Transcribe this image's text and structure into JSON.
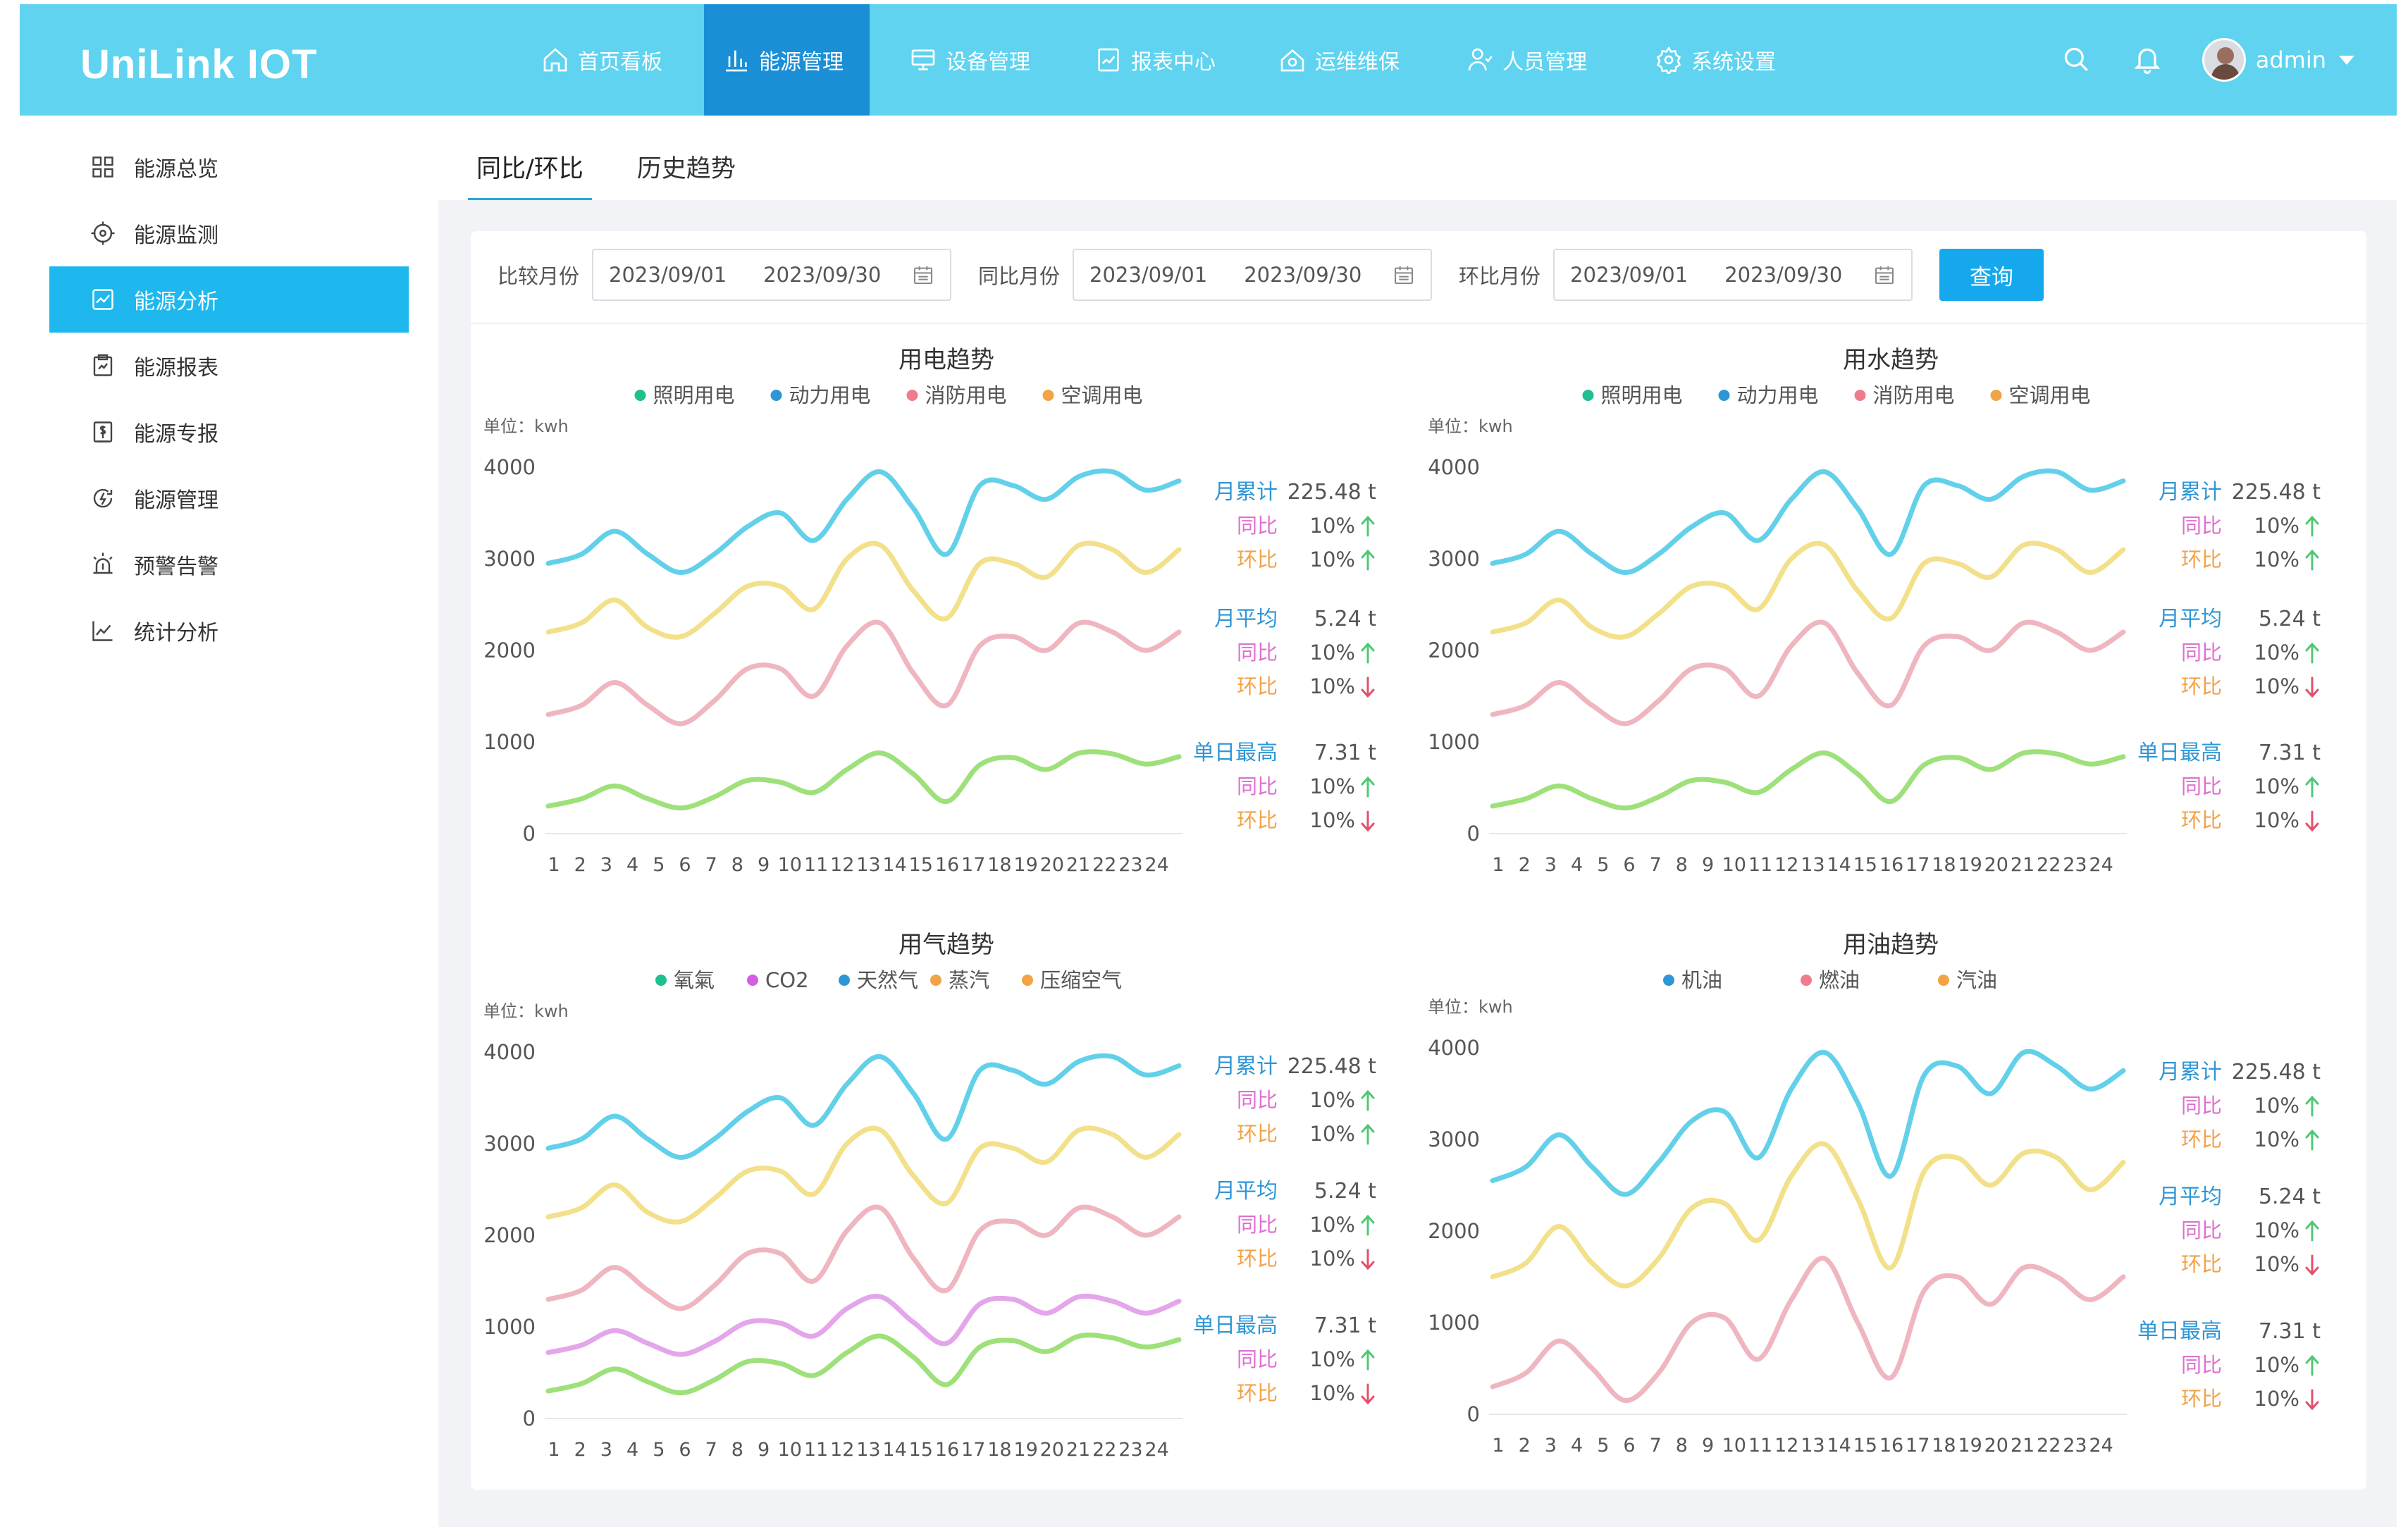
{
  "header": {
    "logo": "UniLink IOT",
    "nav": [
      {
        "label": "首页看板",
        "icon": "home-icon"
      },
      {
        "label": "能源管理",
        "icon": "bar-chart-icon",
        "active": true
      },
      {
        "label": "设备管理",
        "icon": "device-icon"
      },
      {
        "label": "报表中心",
        "icon": "report-icon"
      },
      {
        "label": "运维维保",
        "icon": "maintenance-icon"
      },
      {
        "label": "人员管理",
        "icon": "people-icon"
      },
      {
        "label": "系统设置",
        "icon": "gear-icon"
      }
    ],
    "user": "admin"
  },
  "sidebar": {
    "items": [
      {
        "label": "能源总览",
        "icon": "grid-icon"
      },
      {
        "label": "能源监测",
        "icon": "monitor-icon"
      },
      {
        "label": "能源分析",
        "icon": "analysis-icon",
        "active": true
      },
      {
        "label": "能源报表",
        "icon": "clipboard-icon"
      },
      {
        "label": "能源专报",
        "icon": "special-report-icon"
      },
      {
        "label": "能源管理",
        "icon": "energy-manage-icon"
      },
      {
        "label": "预警告警",
        "icon": "alarm-icon"
      },
      {
        "label": "统计分析",
        "icon": "line-chart-icon"
      }
    ]
  },
  "tabs": [
    {
      "label": "同比/环比",
      "active": true
    },
    {
      "label": "历史趋势"
    }
  ],
  "filters": [
    {
      "label": "比较月份",
      "start": "2023/09/01",
      "end": "2023/09/30"
    },
    {
      "label": "同比月份",
      "start": "2023/09/01",
      "end": "2023/09/30"
    },
    {
      "label": "环比月份",
      "start": "2023/09/01",
      "end": "2023/09/30"
    }
  ],
  "query_label": "查询",
  "colors": {
    "cyan": "#63d0ea",
    "yellow": "#f2e08a",
    "pink": "#efb6c0",
    "green": "#9ee07a",
    "violet": "#e3a6ea",
    "up": "#4fc873",
    "down": "#e2506a",
    "label_blue": "#2f96d6",
    "label_pink": "#e06fcf",
    "label_orange": "#f2a247"
  },
  "stats": [
    {
      "name": "月累计",
      "value": "225.48 t",
      "rows": [
        {
          "label": "同比",
          "value": "10%",
          "dir": "up"
        },
        {
          "label": "环比",
          "value": "10%",
          "dir": "up"
        }
      ]
    },
    {
      "name": "月平均",
      "value": "5.24 t",
      "rows": [
        {
          "label": "同比",
          "value": "10%",
          "dir": "up"
        },
        {
          "label": "环比",
          "value": "10%",
          "dir": "down"
        }
      ]
    },
    {
      "name": "单日最高",
      "value": "7.31 t",
      "rows": [
        {
          "label": "同比",
          "value": "10%",
          "dir": "up"
        },
        {
          "label": "环比",
          "value": "10%",
          "dir": "down"
        }
      ]
    }
  ],
  "chart_data": [
    {
      "type": "line",
      "title": "用电趋势",
      "unit": "单位：kwh",
      "x": [
        1,
        2,
        3,
        4,
        5,
        6,
        7,
        8,
        9,
        10,
        11,
        12,
        13,
        14,
        15,
        16,
        17,
        18,
        19,
        20,
        21,
        22,
        23,
        24
      ],
      "ylim": [
        0,
        4000
      ],
      "yticks": [
        0,
        1000,
        2000,
        3000,
        4000
      ],
      "legend": [
        {
          "name": "照明用电",
          "color": "#1fbf8f"
        },
        {
          "name": "动力用电",
          "color": "#2f96d6"
        },
        {
          "name": "消防用电",
          "color": "#ee7c8c"
        },
        {
          "name": "空调用电",
          "color": "#f2a247"
        }
      ],
      "series": [
        {
          "color": "#63d0ea",
          "values": [
            2950,
            3050,
            3300,
            3050,
            2850,
            3050,
            3350,
            3500,
            3200,
            3650,
            3950,
            3550,
            3050,
            3800,
            3800,
            3650,
            3900,
            3950,
            3750,
            3850
          ]
        },
        {
          "color": "#f2e08a",
          "values": [
            2200,
            2300,
            2550,
            2250,
            2150,
            2400,
            2700,
            2700,
            2450,
            3000,
            3150,
            2650,
            2350,
            2950,
            2950,
            2800,
            3150,
            3100,
            2850,
            3100
          ]
        },
        {
          "color": "#efb6c0",
          "values": [
            1300,
            1400,
            1650,
            1400,
            1200,
            1450,
            1800,
            1800,
            1500,
            2050,
            2300,
            1750,
            1400,
            2050,
            2150,
            2000,
            2300,
            2200,
            2000,
            2200
          ]
        },
        {
          "color": "#9ee07a",
          "values": [
            300,
            380,
            520,
            380,
            280,
            400,
            580,
            560,
            450,
            700,
            880,
            650,
            350,
            750,
            830,
            700,
            880,
            870,
            760,
            840
          ]
        }
      ]
    },
    {
      "type": "line",
      "title": "用水趋势",
      "unit": "单位：kwh",
      "x": [
        1,
        2,
        3,
        4,
        5,
        6,
        7,
        8,
        9,
        10,
        11,
        12,
        13,
        14,
        15,
        16,
        17,
        18,
        19,
        20,
        21,
        22,
        23,
        24
      ],
      "ylim": [
        0,
        4000
      ],
      "yticks": [
        0,
        1000,
        2000,
        3000,
        4000
      ],
      "legend": [
        {
          "name": "照明用电",
          "color": "#1fbf8f"
        },
        {
          "name": "动力用电",
          "color": "#2f96d6"
        },
        {
          "name": "消防用电",
          "color": "#ee7c8c"
        },
        {
          "name": "空调用电",
          "color": "#f2a247"
        }
      ],
      "series": [
        {
          "color": "#63d0ea",
          "values": [
            2950,
            3050,
            3300,
            3050,
            2850,
            3050,
            3350,
            3500,
            3200,
            3650,
            3950,
            3550,
            3050,
            3800,
            3800,
            3650,
            3900,
            3950,
            3750,
            3850
          ]
        },
        {
          "color": "#f2e08a",
          "values": [
            2200,
            2300,
            2550,
            2250,
            2150,
            2400,
            2700,
            2700,
            2450,
            3000,
            3150,
            2650,
            2350,
            2950,
            2950,
            2800,
            3150,
            3100,
            2850,
            3100
          ]
        },
        {
          "color": "#efb6c0",
          "values": [
            1300,
            1400,
            1650,
            1400,
            1200,
            1450,
            1800,
            1800,
            1500,
            2050,
            2300,
            1750,
            1400,
            2050,
            2150,
            2000,
            2300,
            2200,
            2000,
            2200
          ]
        },
        {
          "color": "#9ee07a",
          "values": [
            300,
            380,
            520,
            380,
            280,
            400,
            580,
            560,
            450,
            700,
            880,
            650,
            350,
            750,
            830,
            700,
            880,
            870,
            760,
            840
          ]
        }
      ]
    },
    {
      "type": "line",
      "title": "用气趋势",
      "unit": "单位：kwh",
      "x": [
        1,
        2,
        3,
        4,
        5,
        6,
        7,
        8,
        9,
        10,
        11,
        12,
        13,
        14,
        15,
        16,
        17,
        18,
        19,
        20,
        21,
        22,
        23,
        24
      ],
      "ylim": [
        0,
        4000
      ],
      "yticks": [
        0,
        1000,
        2000,
        3000,
        4000
      ],
      "legend": [
        {
          "name": "氧氣",
          "color": "#1fbf8f"
        },
        {
          "name": "CO2",
          "color": "#d65ce6"
        },
        {
          "name": "天然气",
          "color": "#2f96d6"
        },
        {
          "name": "蒸汽",
          "color": "#f2a247"
        },
        {
          "name": "压缩空气",
          "color": "#f2a247"
        }
      ],
      "series": [
        {
          "color": "#63d0ea",
          "values": [
            2950,
            3050,
            3300,
            3050,
            2850,
            3050,
            3350,
            3500,
            3200,
            3650,
            3950,
            3550,
            3050,
            3800,
            3800,
            3650,
            3900,
            3950,
            3750,
            3850
          ]
        },
        {
          "color": "#f2e08a",
          "values": [
            2200,
            2300,
            2550,
            2250,
            2150,
            2400,
            2700,
            2700,
            2450,
            3000,
            3150,
            2650,
            2350,
            2950,
            2950,
            2800,
            3150,
            3100,
            2850,
            3100
          ]
        },
        {
          "color": "#efb6c0",
          "values": [
            1300,
            1400,
            1650,
            1400,
            1200,
            1450,
            1800,
            1800,
            1500,
            2050,
            2300,
            1750,
            1400,
            2050,
            2150,
            2000,
            2300,
            2200,
            2000,
            2200
          ]
        },
        {
          "color": "#e3a6ea",
          "values": [
            720,
            800,
            960,
            820,
            700,
            840,
            1050,
            1040,
            900,
            1200,
            1330,
            1050,
            820,
            1250,
            1300,
            1150,
            1330,
            1280,
            1150,
            1280
          ]
        },
        {
          "color": "#9ee07a",
          "values": [
            300,
            380,
            540,
            400,
            280,
            420,
            620,
            600,
            470,
            720,
            900,
            670,
            370,
            780,
            850,
            730,
            900,
            880,
            780,
            860
          ]
        }
      ]
    },
    {
      "type": "line",
      "title": "用油趋势",
      "unit": "单位：kwh",
      "x": [
        1,
        2,
        3,
        4,
        5,
        6,
        7,
        8,
        9,
        10,
        11,
        12,
        13,
        14,
        15,
        16,
        17,
        18,
        19,
        20,
        21,
        22,
        23,
        24
      ],
      "ylim": [
        0,
        4000
      ],
      "yticks": [
        0,
        1000,
        2000,
        3000,
        4000
      ],
      "legend": [
        {
          "name": "机油",
          "color": "#2f96d6"
        },
        {
          "name": "燃油",
          "color": "#ee7c8c"
        },
        {
          "name": "汽油",
          "color": "#f2a247"
        }
      ],
      "series": [
        {
          "color": "#63d0ea",
          "values": [
            2550,
            2700,
            3050,
            2700,
            2400,
            2750,
            3200,
            3300,
            2800,
            3550,
            3950,
            3400,
            2600,
            3700,
            3800,
            3500,
            3950,
            3800,
            3550,
            3750
          ]
        },
        {
          "color": "#f2e08a",
          "values": [
            1500,
            1650,
            2050,
            1650,
            1400,
            1700,
            2250,
            2300,
            1900,
            2600,
            2950,
            2350,
            1600,
            2650,
            2800,
            2500,
            2850,
            2800,
            2450,
            2750
          ]
        },
        {
          "color": "#efb6c0",
          "values": [
            300,
            450,
            800,
            500,
            150,
            450,
            1000,
            1050,
            600,
            1250,
            1700,
            1000,
            400,
            1350,
            1500,
            1200,
            1600,
            1500,
            1250,
            1500
          ]
        }
      ]
    }
  ]
}
